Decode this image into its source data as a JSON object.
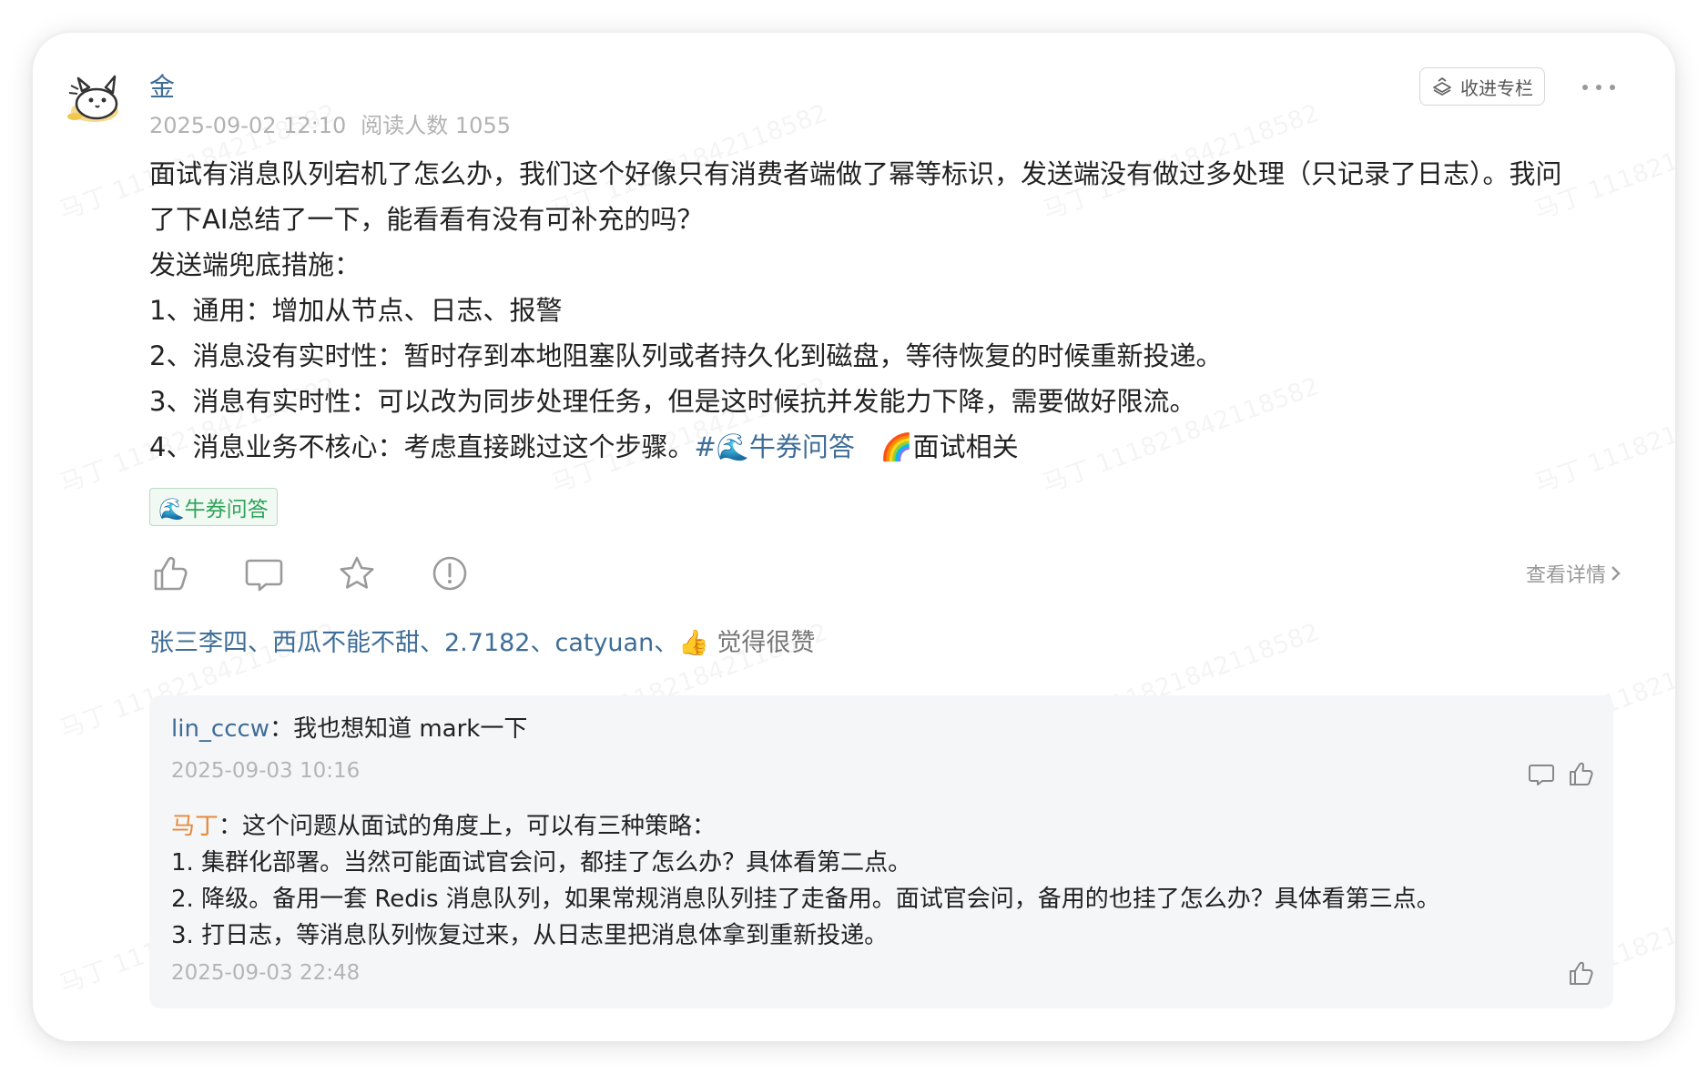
{
  "post": {
    "author": "金",
    "date": "2025-09-02 12:10",
    "read_count": "阅读人数 1055",
    "collect_label": "收进专栏",
    "lines": [
      "面试有消息队列宕机了怎么办，我们这个好像只有消费者端做了幂等标识，发送端没有做过多处理（只记录了日志）。我问",
      "了下AI总结了一下，能看看有没有可补充的吗？",
      "发送端兜底措施：",
      "1、通用：增加从节点、日志、报警",
      "2、消息没有实时性：暂时存到本地阻塞队列或者持久化到磁盘，等待恢复的时候重新投递。",
      "3、消息有实时性：可以改为同步处理任务，但是这时候抗并发能力下降，需要做好限流。"
    ],
    "last_line_text": "4、消息业务不核心：考虑直接跳过这个步骤。",
    "topic_link": "#🌊牛券问答",
    "topic2": "🌈面试相关",
    "tag": "🌊牛券问答",
    "view_detail": "查看详情",
    "likers_names": "张三李四、西瓜不能不甜、2.7182、catyuan、",
    "likers_emoji": "👍",
    "likers_suffix": "觉得很赞"
  },
  "comments": [
    {
      "name": "lin_cccw",
      "separator": "：",
      "text": "我也想知道 mark一下",
      "time": "2025-09-03 10:16"
    },
    {
      "name": "马丁",
      "separator": "：",
      "first_line": "这个问题从面试的角度上，可以有三种策略：",
      "lines": [
        "1. 集群化部署。当然可能面试官会问，都挂了怎么办？具体看第二点。",
        "2. 降级。备用一套 Redis 消息队列，如果常规消息队列挂了走备用。面试官会问，备用的也挂了怎么办？具体看第三点。",
        "3. 打日志，等消息队列恢复过来，从日志里把消息体拿到重新投递。"
      ],
      "time": "2025-09-03 22:48"
    }
  ],
  "watermark": "马丁 111821842118582",
  "icons": [
    "avatar-icon",
    "collect-icon",
    "more-icon",
    "like-icon",
    "comment-icon",
    "star-icon",
    "report-icon",
    "chevron-right-icon",
    "reply-icon"
  ]
}
